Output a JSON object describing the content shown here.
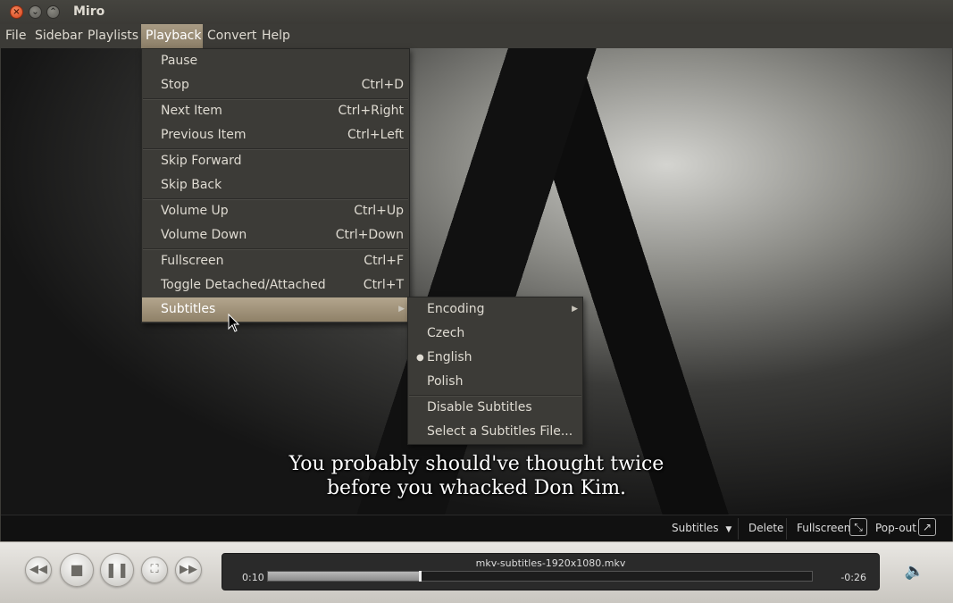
{
  "window": {
    "title": "Miro"
  },
  "menubar": [
    "File",
    "Sidebar",
    "Playlists",
    "Playback",
    "Convert",
    "Help"
  ],
  "playback_menu": [
    {
      "label": "Pause",
      "accel": ""
    },
    {
      "label": "Stop",
      "accel": "Ctrl+D"
    },
    {
      "label": "Next Item",
      "accel": "Ctrl+Right"
    },
    {
      "label": "Previous Item",
      "accel": "Ctrl+Left"
    },
    {
      "label": "Skip Forward",
      "accel": ""
    },
    {
      "label": "Skip Back",
      "accel": ""
    },
    {
      "label": "Volume Up",
      "accel": "Ctrl+Up"
    },
    {
      "label": "Volume Down",
      "accel": "Ctrl+Down"
    },
    {
      "label": "Fullscreen",
      "accel": "Ctrl+F"
    },
    {
      "label": "Toggle Detached/Attached",
      "accel": "Ctrl+T"
    },
    {
      "label": "Subtitles",
      "accel": ""
    }
  ],
  "subtitles_menu": [
    {
      "label": "Encoding"
    },
    {
      "label": "Czech"
    },
    {
      "label": "English"
    },
    {
      "label": "Polish"
    },
    {
      "label": "Disable Subtitles"
    },
    {
      "label": "Select a Subtitles File..."
    }
  ],
  "video": {
    "subtitle_line1": "You probably should've thought twice",
    "subtitle_line2": "before you whacked Don Kim."
  },
  "video_toolbar": {
    "subtitles": "Subtitles",
    "delete": "Delete",
    "fullscreen": "Fullscreen",
    "popout": "Pop-out"
  },
  "now_playing": {
    "filename": "mkv-subtitles-1920x1080.mkv",
    "elapsed": "0:10",
    "remaining": "-0:26",
    "progress_fraction": 0.278
  },
  "icons": {
    "back": "rewind-icon",
    "stop": "stop-icon",
    "pause": "pause-icon",
    "fullscreen": "fullscreen-icon",
    "forward": "fast-forward-icon",
    "volume": "volume-icon"
  }
}
